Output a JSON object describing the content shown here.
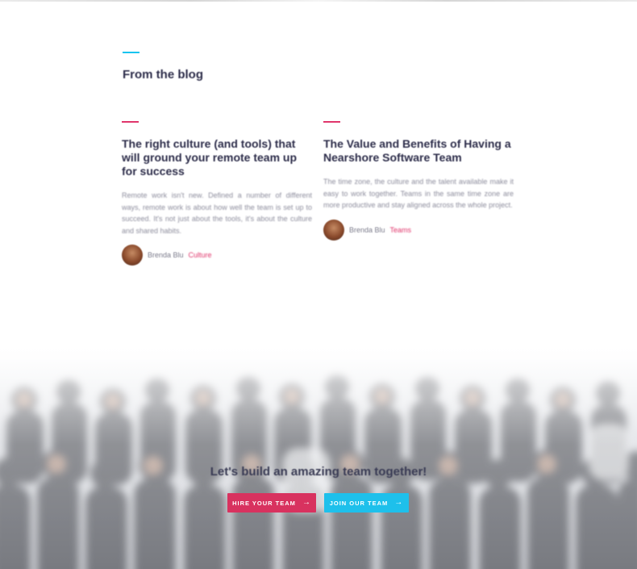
{
  "blog": {
    "heading": "From the blog",
    "posts": [
      {
        "title": "The right culture (and tools) that will ground your remote team up for success",
        "excerpt": "Remote work isn't new. Defined a number of different ways, remote work is about how well the team is set up to succeed. It's not just about the tools, it's about the culture and shared habits.",
        "author": "Brenda Blu",
        "category": "Culture"
      },
      {
        "title": "The Value and Benefits of Having a Nearshore Software Team",
        "excerpt": "The time zone, the culture and the talent available make it easy to work together. Teams in the same time zone are more productive and stay aligned across the whole project.",
        "author": "Brenda Blu",
        "category": "Teams"
      }
    ]
  },
  "cta": {
    "headline": "Let's build an amazing team together!",
    "hire_label": "HIRE YOUR TEAM",
    "join_label": "JOIN OUR TEAM",
    "arrow": "→"
  },
  "colors": {
    "accent_cyan": "#17c4f0",
    "accent_pink": "#e0356b",
    "hire_button": "#d8325f",
    "join_button": "#1ec0eb"
  }
}
